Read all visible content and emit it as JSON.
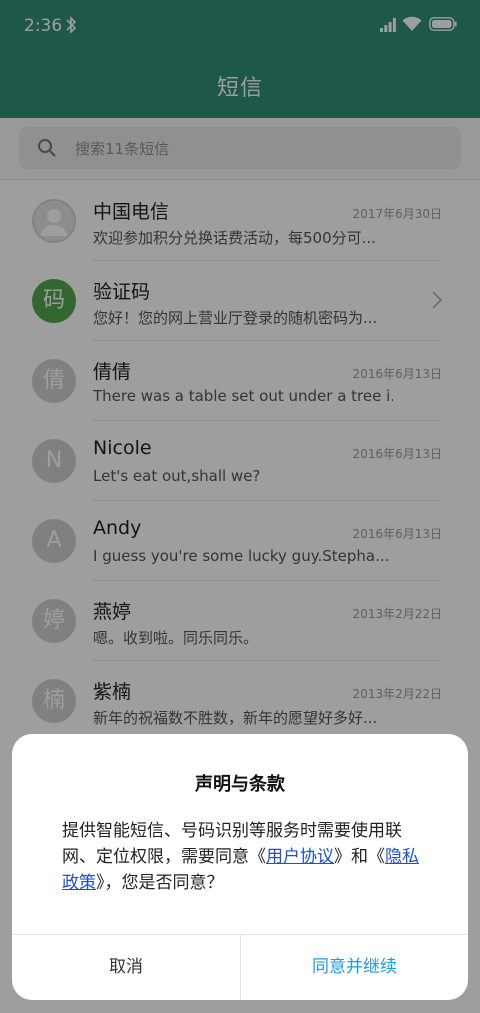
{
  "status": {
    "time": "2:36"
  },
  "app": {
    "title": "短信"
  },
  "search": {
    "placeholder": "搜索11条短信"
  },
  "messages": [
    {
      "name": "中国电信",
      "preview": "欢迎参加积分兑换话费活动，每500分可...",
      "date": "2017年6月30日",
      "avatar": ""
    },
    {
      "name": "验证码",
      "preview": "您好！您的网上营业厅登录的随机密码为...",
      "date": "",
      "avatar": "码"
    },
    {
      "name": "倩倩",
      "preview": "There was a table set out under a tree i...",
      "date": "2016年6月13日",
      "avatar": "倩"
    },
    {
      "name": "Nicole",
      "preview": "Let's eat out,shall we?",
      "date": "2016年6月13日",
      "avatar": "N"
    },
    {
      "name": "Andy",
      "preview": "I guess you're some lucky guy.Stepha...",
      "date": "2016年6月13日",
      "avatar": "A"
    },
    {
      "name": "燕婷",
      "preview": "嗯。收到啦。同乐同乐。",
      "date": "2013年2月22日",
      "avatar": "婷"
    },
    {
      "name": "紫楠",
      "preview": "新年的祝福数不胜数，新年的愿望好多好...",
      "date": "2013年2月22日",
      "avatar": "楠"
    }
  ],
  "dialog": {
    "title": "声明与条款",
    "body_part1": "提供智能短信、号码识别等服务时需要使用联网、定位权限，需要同意《",
    "link_user": "用户协议",
    "body_part2": "》和《",
    "link_privacy": "隐私政策",
    "body_part3": "》，您是否同意？",
    "cancel": "取消",
    "confirm": "同意并继续"
  },
  "colors": {
    "primary": "#2f8f79",
    "link": "#1a4fd6",
    "confirm": "#1e9be6",
    "verify_avatar": "#52a64c"
  }
}
